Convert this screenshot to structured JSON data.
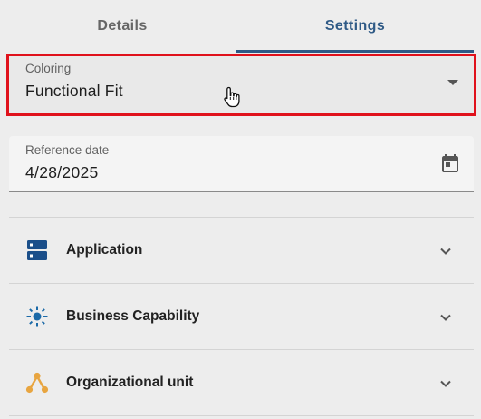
{
  "tabs": [
    {
      "label": "Details",
      "active": false
    },
    {
      "label": "Settings",
      "active": true
    }
  ],
  "coloring": {
    "label": "Coloring",
    "value": "Functional Fit"
  },
  "reference_date": {
    "label": "Reference date",
    "value": "4/28/2025",
    "icon": "calendar-icon"
  },
  "accordion": [
    {
      "label": "Application",
      "icon": "application-server-icon",
      "color": "#1b4f8a"
    },
    {
      "label": "Business Capability",
      "icon": "business-capability-icon",
      "color": "#1c6aa8"
    },
    {
      "label": "Organizational unit",
      "icon": "organizational-unit-icon",
      "color": "#e8a540"
    }
  ],
  "colors": {
    "accent": "#2f5a86",
    "highlight": "#e0121c"
  }
}
